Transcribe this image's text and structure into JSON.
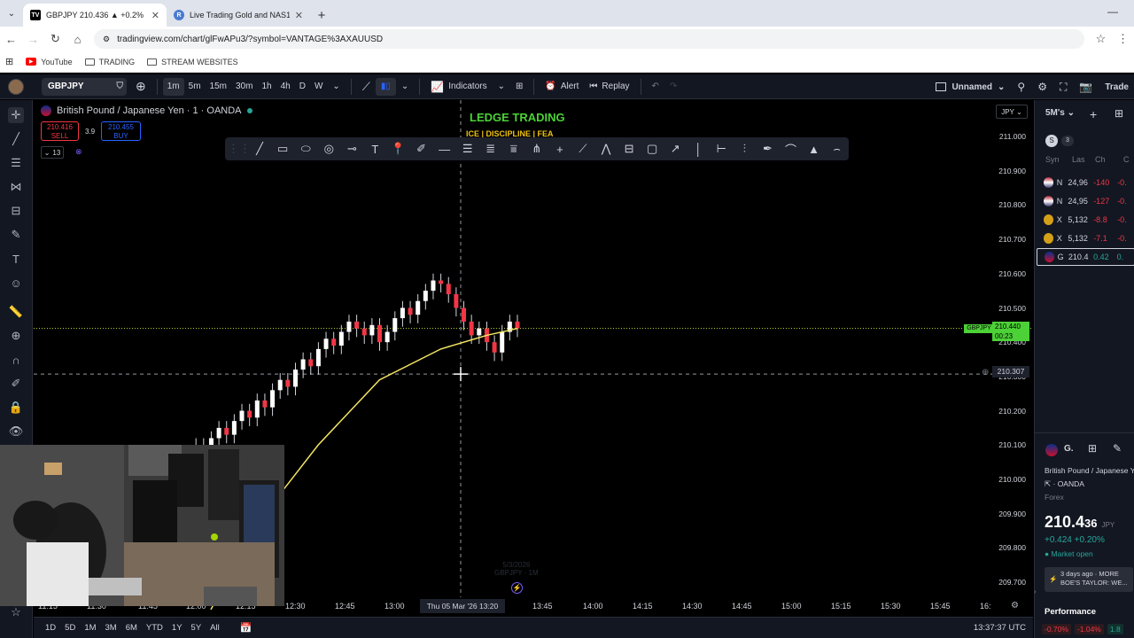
{
  "browser": {
    "tabs": [
      {
        "title": "GBPJPY 210.436 ▲ +0.2% Unna",
        "favicon": "tradingview-icon",
        "active": true
      },
      {
        "title": "Live Trading Gold and NAS100",
        "favicon": "r-icon",
        "active": false
      }
    ],
    "url": "tradingview.com/chart/glFwAPu3/?symbol=VANTAGE%3AXAUUSD",
    "bookmarks": [
      "YouTube",
      "TRADING",
      "STREAM WEBSITES"
    ]
  },
  "toolbar": {
    "symbol": "GBPJPY",
    "timeframes": [
      "1m",
      "5m",
      "15m",
      "30m",
      "1h",
      "4h",
      "D",
      "W"
    ],
    "active_timeframe": "1m",
    "indicators_label": "Indicators",
    "alert_label": "Alert",
    "replay_label": "Replay",
    "layout_name": "Unnamed",
    "trade_label": "Trade"
  },
  "legend": {
    "title": "British Pound / Japanese Yen · 1 · OANDA",
    "sell_price": "210.416",
    "sell_label": "SELL",
    "spread": "3.9",
    "buy_price": "210.455",
    "buy_label": "BUY",
    "indicator_count": "13"
  },
  "overlay": {
    "brand": "LEDGE TRADING",
    "tagline": "ICE | DISCIPLINE | FEA"
  },
  "chart_data": {
    "type": "candlestick",
    "symbol": "GBPJPY",
    "currency": "JPY",
    "price_ticks": [
      "211.000",
      "210.900",
      "210.800",
      "210.700",
      "210.600",
      "210.500",
      "210.400",
      "210.300",
      "210.200",
      "210.100",
      "210.000",
      "209.900",
      "209.800",
      "209.700"
    ],
    "time_ticks": [
      "11:15",
      "11:30",
      "11:45",
      "12:00",
      "12:15",
      "12:30",
      "12:45",
      "13:00",
      "13:45",
      "14:00",
      "14:15",
      "14:30",
      "14:45",
      "15:00",
      "15:15",
      "15:30",
      "15:45",
      "16:"
    ],
    "current_price": "210.440",
    "current_countdown": "00:23",
    "crosshair_price": "210.307",
    "crosshair_time": "Thu 05 Mar '26   13:20",
    "ylim": [
      209.66,
      211.08
    ],
    "ma_line": [
      [
        0,
        209.62
      ],
      [
        0.15,
        209.87
      ],
      [
        0.35,
        210.1
      ],
      [
        0.55,
        210.29
      ],
      [
        0.75,
        210.38
      ],
      [
        0.9,
        210.42
      ],
      [
        1.0,
        210.44
      ]
    ],
    "closes": [
      209.95,
      209.97,
      210.01,
      209.98,
      210.05,
      210.1,
      210.08,
      210.12,
      210.15,
      210.13,
      210.17,
      210.2,
      210.18,
      210.23,
      210.21,
      210.26,
      210.29,
      210.27,
      210.32,
      210.35,
      210.33,
      210.38,
      210.41,
      210.39,
      210.43,
      210.46,
      210.44,
      210.42,
      210.45,
      210.4,
      210.43,
      210.47,
      210.5,
      210.48,
      210.52,
      210.55,
      210.58,
      210.57,
      210.54,
      210.5,
      210.46,
      210.42,
      210.44,
      210.4,
      210.37,
      210.43,
      210.46,
      210.44
    ]
  },
  "bottom": {
    "ranges": [
      "1D",
      "5D",
      "1M",
      "3M",
      "6M",
      "YTD",
      "1Y",
      "5Y",
      "All"
    ],
    "clock": "13:37:37 UTC",
    "watermark_date": "5/3/2026",
    "watermark_sym": "GBPJPY · 1M"
  },
  "watchlist": {
    "title": "5M's",
    "count": "3",
    "columns": [
      "Syn",
      "Las",
      "Ch",
      "C"
    ],
    "rows": [
      {
        "sym": "N",
        "last": "24,96",
        "chg": "-140",
        "pct": "-0.",
        "color": "#f23645"
      },
      {
        "sym": "N",
        "last": "24,95",
        "chg": "-127",
        "pct": "-0.",
        "color": "#f23645"
      },
      {
        "sym": "X",
        "last": "5,132",
        "chg": "-8.8",
        "pct": "-0.",
        "color": "#f23645"
      },
      {
        "sym": "X",
        "last": "5,132",
        "chg": "-7.1",
        "pct": "-0.",
        "color": "#f23645"
      },
      {
        "sym": "G",
        "last": "210.4",
        "chg": "0.42",
        "pct": "0.",
        "color": "#26a69a"
      }
    ],
    "detail": {
      "sym": "G.",
      "name": "British Pound / Japanese Y",
      "broker": "OANDA",
      "type": "Forex",
      "price_main": "210.4",
      "price_tail": "36",
      "price_unit": "JPY",
      "change": "+0.424  +0.20%",
      "status": "Market open",
      "news": "3 days ago · MORE BOE'S TAYLOR: WE...",
      "performance_label": "Performance",
      "perf_values": [
        "-0.70%",
        "-1.04%",
        "1.8"
      ]
    }
  }
}
